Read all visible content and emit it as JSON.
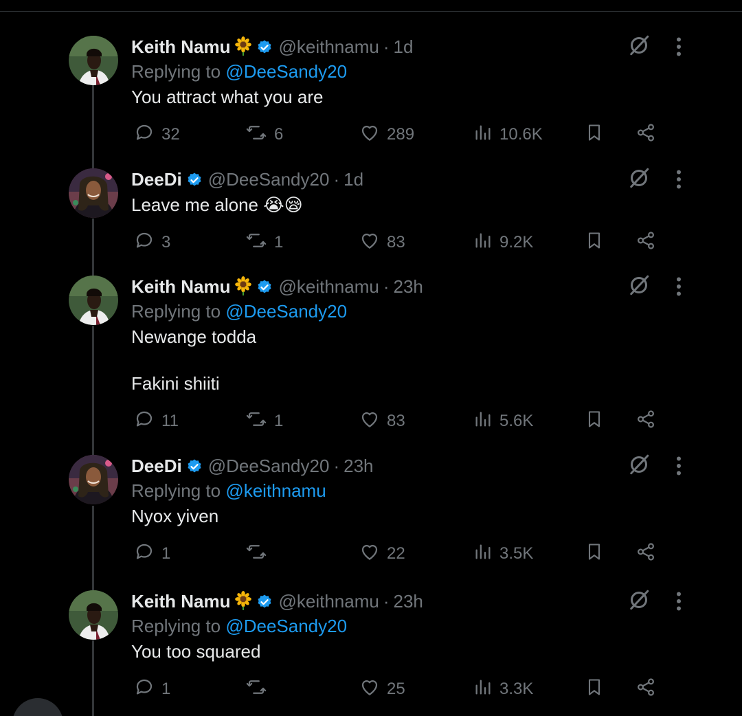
{
  "tweets": [
    {
      "name": "Keith Namu",
      "has_emoji": true,
      "handle": "@keithnamu",
      "dot": "·",
      "time": "1d",
      "replying_prefix": "Replying to ",
      "replying_to": "@DeeSandy20",
      "text": [
        "You attract what you are"
      ],
      "replies": "32",
      "retweets": "6",
      "likes": "289",
      "views": "10.6K"
    },
    {
      "name": "DeeDi",
      "has_emoji": false,
      "handle": "@DeeSandy20",
      "dot": "·",
      "time": "1d",
      "replying_prefix": "",
      "replying_to": "",
      "text": [
        "Leave me alone 😭😪"
      ],
      "replies": "3",
      "retweets": "1",
      "likes": "83",
      "views": "9.2K"
    },
    {
      "name": "Keith Namu",
      "has_emoji": true,
      "handle": "@keithnamu",
      "dot": "·",
      "time": "23h",
      "replying_prefix": "Replying to ",
      "replying_to": "@DeeSandy20",
      "text": [
        "Newange todda",
        "Fakini shiiti"
      ],
      "replies": "11",
      "retweets": "1",
      "likes": "83",
      "views": "5.6K"
    },
    {
      "name": "DeeDi",
      "has_emoji": false,
      "handle": "@DeeSandy20",
      "dot": "·",
      "time": "23h",
      "replying_prefix": "Replying to ",
      "replying_to": "@keithnamu",
      "text": [
        "Nyox yiven"
      ],
      "replies": "1",
      "retweets": "",
      "likes": "22",
      "views": "3.5K"
    },
    {
      "name": "Keith Namu",
      "has_emoji": true,
      "handle": "@keithnamu",
      "dot": "·",
      "time": "23h",
      "replying_prefix": "Replying to ",
      "replying_to": "@DeeSandy20",
      "text": [
        "You too squared"
      ],
      "replies": "1",
      "retweets": "",
      "likes": "25",
      "views": "3.3K"
    }
  ],
  "icons": {
    "reply": "reply-icon",
    "retweet": "retweet-icon",
    "like": "heart-icon",
    "views": "views-icon",
    "bookmark": "bookmark-icon",
    "share": "share-icon",
    "grok": "grok-icon",
    "more": "more-icon",
    "verified": "verified-badge-icon",
    "emoji": "sunflower-emoji-icon"
  },
  "colors": {
    "background": "#000000",
    "text": "#e7e9ea",
    "muted": "#71767b",
    "link": "#1d9bf0",
    "verified": "#1d9bf0",
    "thread_line": "#333639"
  }
}
